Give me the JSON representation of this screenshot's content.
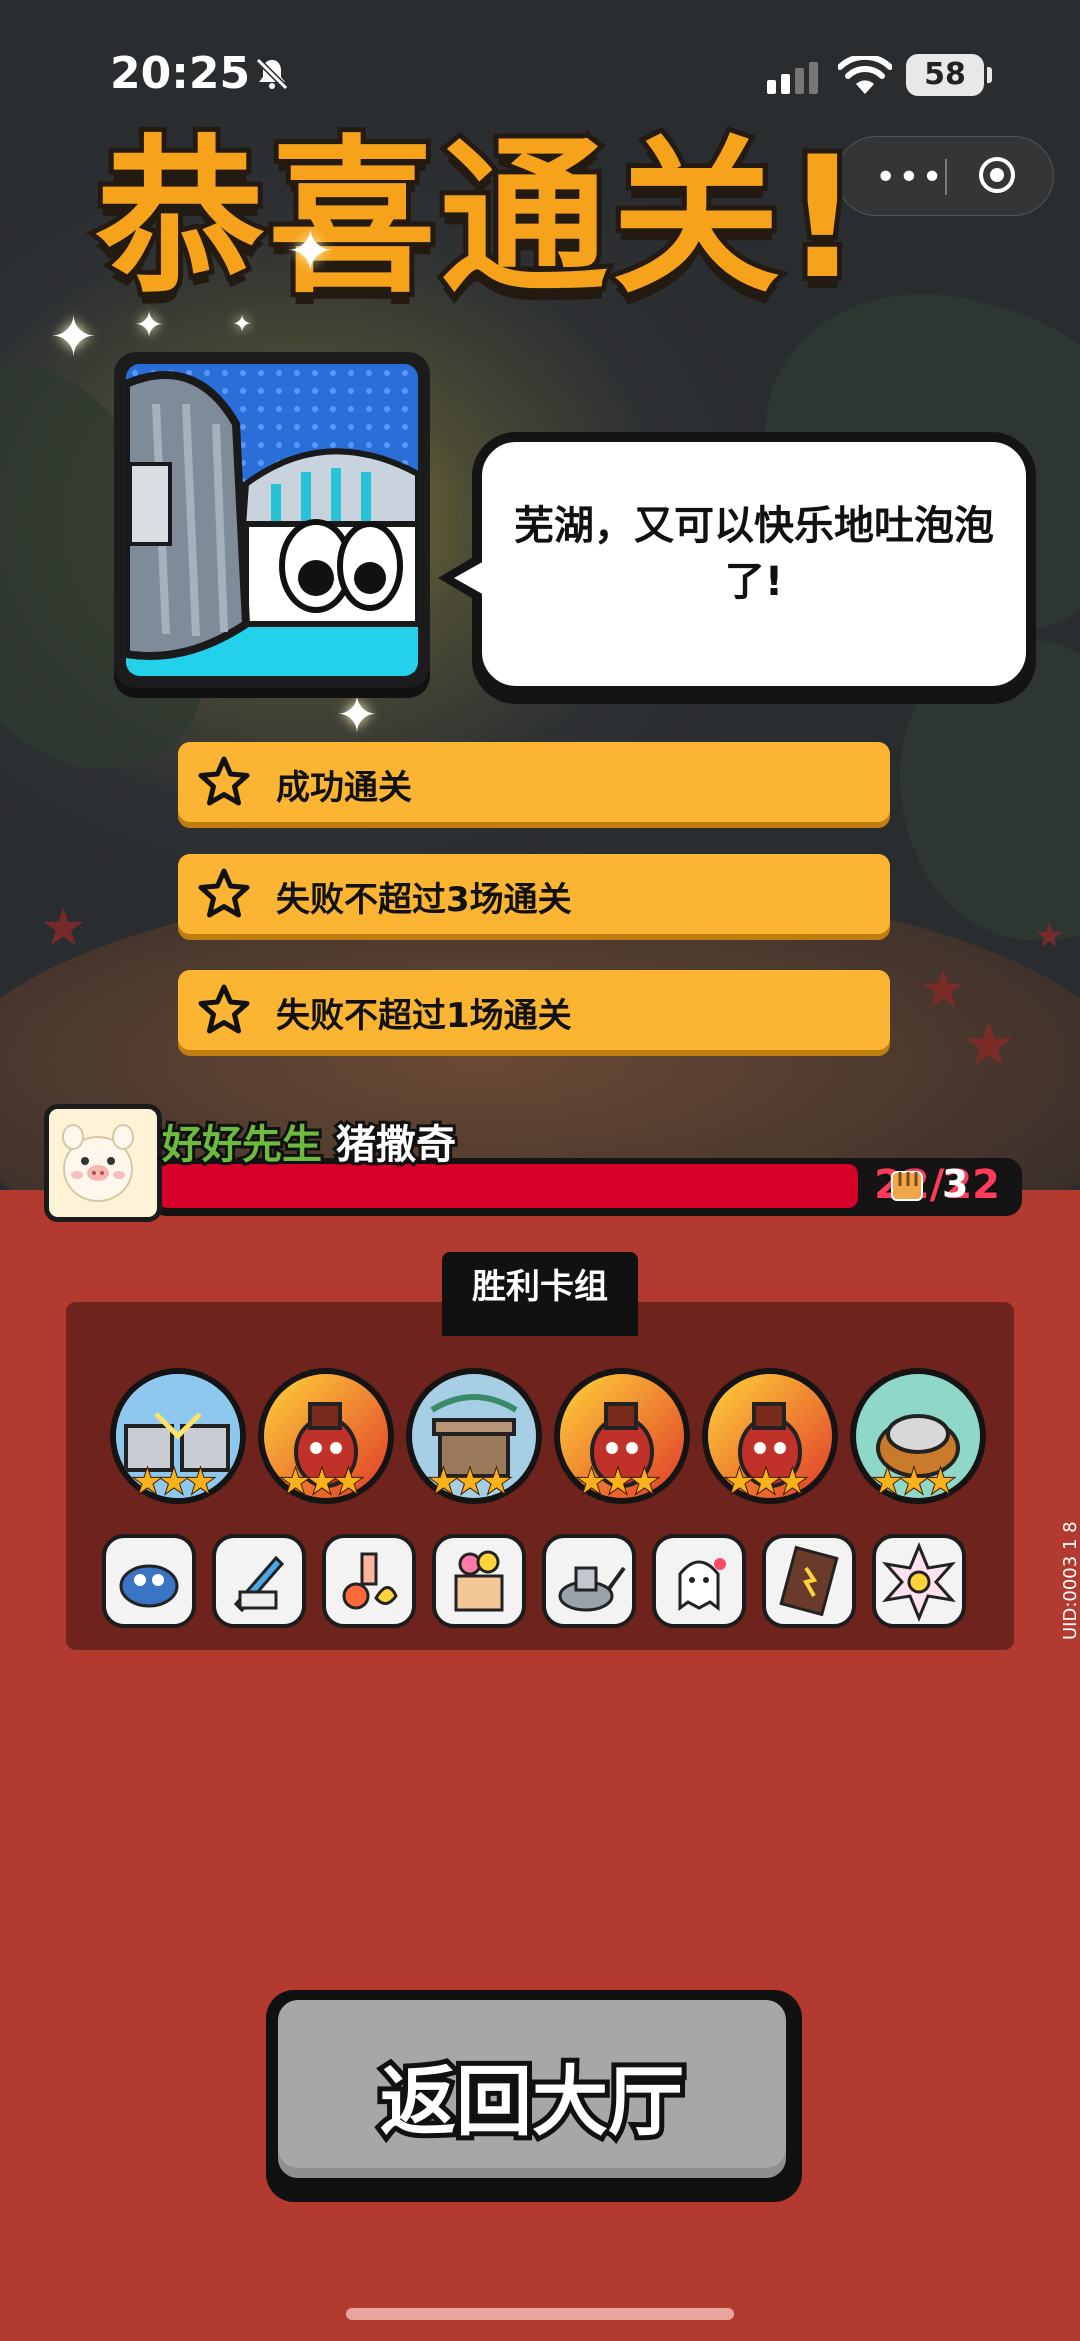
{
  "status_bar": {
    "time": "20:25",
    "battery": "58"
  },
  "title": "恭喜通关!",
  "dialog": {
    "text": "芜湖，又可以快乐地吐泡泡了!"
  },
  "goals": [
    {
      "label": "成功通关"
    },
    {
      "label": "失败不超过3场通关"
    },
    {
      "label": "失败不超过1场通关"
    }
  ],
  "player": {
    "title": "好好先生",
    "name": "猪撒奇",
    "hp": "22/22",
    "hp_fraction": 1.0,
    "power": "3"
  },
  "deck": {
    "label": "胜利卡组",
    "heroes": [
      {
        "icon": "twin-robots-hero-icon",
        "stars": "★★★"
      },
      {
        "icon": "bomb-creature-hero-icon",
        "stars": "★★★"
      },
      {
        "icon": "treasure-box-hero-icon",
        "stars": "★★★"
      },
      {
        "icon": "bomb-creature-hero-icon",
        "stars": "★★★"
      },
      {
        "icon": "bomb-creature-hero-icon",
        "stars": "★★★"
      },
      {
        "icon": "fish-can-hero-icon",
        "stars": "★★★"
      }
    ],
    "items": [
      "crab-item-icon",
      "rocket-item-icon",
      "fruit-drinks-item-icon",
      "ice-cream-cart-item-icon",
      "robot-pan-item-icon",
      "ghost-chef-item-icon",
      "chocolate-bar-item-icon",
      "energy-burst-item-icon"
    ]
  },
  "uid": "UID:0003 1 8",
  "back_button": {
    "label": "返回大厅"
  },
  "colors": {
    "title": "#f7a21b",
    "goal_bg": "#fbb532",
    "hp_fill": "#d6002a",
    "deck_bg": "#6e231c",
    "page_bg": "#b33a2f"
  }
}
